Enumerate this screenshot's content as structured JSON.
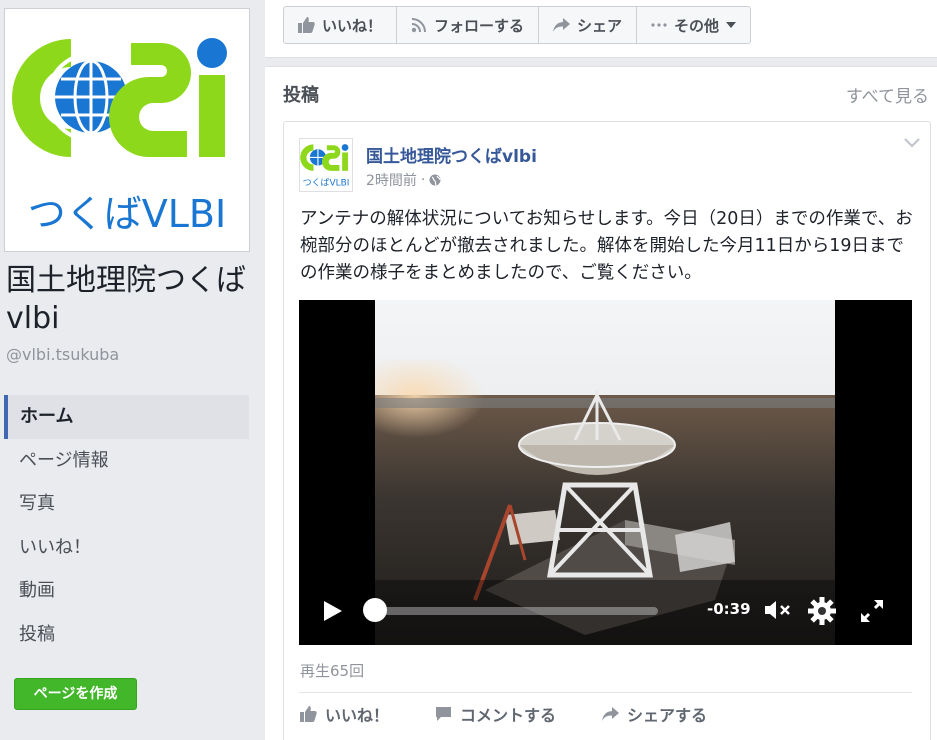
{
  "page": {
    "name": "国土地理院つくばvlbi",
    "handle": "@vlbi.tsukuba",
    "logo_text": "つくばVLBI",
    "colors": {
      "brand_green": "#7ed321",
      "brand_blue": "#1a73e8",
      "link": "#365899",
      "create_button": "#42b72a"
    }
  },
  "sidebar": {
    "items": [
      {
        "label": "ホーム",
        "active": true
      },
      {
        "label": "ページ情報"
      },
      {
        "label": "写真"
      },
      {
        "label": "いいね！"
      },
      {
        "label": "動画"
      },
      {
        "label": "投稿"
      }
    ],
    "create_page_label": "ページを作成"
  },
  "action_bar": {
    "like_label": "いいね！",
    "follow_label": "フォローする",
    "share_label": "シェア",
    "more_label": "その他",
    "icons": [
      "thumbs-up-icon",
      "rss-icon",
      "share-arrow-icon",
      "ellipsis-icon",
      "caret-down-icon"
    ]
  },
  "posts": {
    "header": "投稿",
    "see_all_label": "すべて見る",
    "post": {
      "author": "国土地理院つくばvlbi",
      "time": "2時間前",
      "privacy_icon": "globe-icon",
      "text": "アンテナの解体状況についてお知らせします。今日（20日）までの作業で、お椀部分のほとんどが撤去されました。解体を開始した今月11日から19日までの作業の様子をまとめましたので、ご覧ください。",
      "video": {
        "time_remaining": "-0:39",
        "progress": 0.03,
        "muted": true
      },
      "play_count": "再生65回",
      "actions": {
        "like_label": "いいね！",
        "comment_label": "コメントする",
        "share_label": "シェアする"
      }
    }
  }
}
